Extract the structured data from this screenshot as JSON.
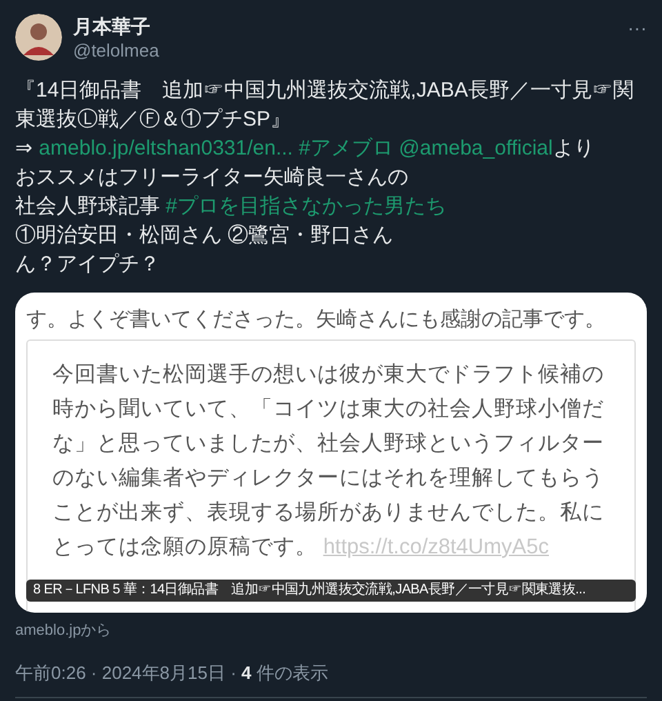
{
  "author": {
    "name": "月本華子",
    "handle": "@telolmea",
    "more": "···"
  },
  "body": [
    [
      {
        "kind": "text",
        "text": "『14日御品書　追加☞中国九州選抜交流戦,JABA長野／一寸見☞関東選抜Ⓛ戦／Ⓕ＆①プチSP』"
      }
    ],
    [
      {
        "kind": "text",
        "text": "⇒"
      },
      {
        "kind": "link",
        "text": "ameblo.jp/eltshan0331/en..."
      },
      {
        "kind": "link",
        "text": "#アメブロ"
      },
      {
        "kind": "link",
        "text": "@ameba_official"
      },
      {
        "kind": "text",
        "text": "より"
      }
    ],
    [
      {
        "kind": "text",
        "text": "おススメはフリーライター矢崎良一さんの"
      }
    ],
    [
      {
        "kind": "text",
        "text": "社会人野球記事"
      },
      {
        "kind": "link",
        "text": "#プロを目指さなかった男たち"
      }
    ],
    [
      {
        "kind": "text",
        "text": "①明治安田・松岡さん ②鷺宮・野口さん"
      }
    ],
    [
      {
        "kind": "text",
        "text": "ん？アイプチ？"
      }
    ]
  ],
  "card": {
    "intro": "す。よくぞ書いてくださった。矢崎さんにも感謝の記事です。",
    "quote": "今回書いた松岡選手の想いは彼が東大でドラフト候補の時から聞いていて、「コイツは東大の社会人野球小僧だな」と思っていましたが、社会人野球というフィルターのない編集者やディレクターにはそれを理解してもらうことが出来ず、表現する場所がありませんでした。私にとっては念願の原稿です。",
    "quote_link": "https://t.co/z8t4UmyA5c",
    "caption": "8 ER－LFNB 5 華：14日御品書　追加☞中国九州選抜交流戦,JABA長野／一寸見☞関東選抜..."
  },
  "source": "ameblo.jpから",
  "meta": {
    "time": "午前0:26 · 2024年8月15日 · ",
    "views": "4",
    "views_label": " 件の表示"
  }
}
